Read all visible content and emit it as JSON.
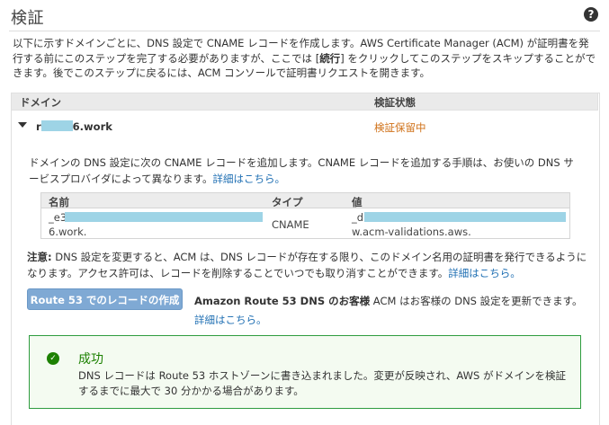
{
  "page": {
    "title": "検証",
    "intro_parts": [
      "以下に示すドメインごとに、DNS 設定で CNAME レコードを作成します。AWS Certificate Manager (ACM) が証明書を発行する前にこのステップを完了する必要がありますが、ここでは [",
      "続行",
      "] をクリックしてこのステップをスキップすることができます。後でこのステップに戻るには、ACM コンソールで証明書リクエストを開きます。"
    ]
  },
  "table": {
    "col_domain": "ドメイン",
    "col_status": "検証状態",
    "row": {
      "domain_prefix": "r",
      "domain_suffix": "6.work",
      "status": "検証保留中"
    }
  },
  "dns_note": {
    "text": "ドメインの DNS 設定に次の CNAME レコードを追加します。CNAME レコードを追加する手順は、お使いの DNS サービスプロバイダによって異なります。",
    "link": "詳細はこちら。"
  },
  "record": {
    "h_name": "名前",
    "h_type": "タイプ",
    "h_value": "値",
    "name_line1": "_e3",
    "name_line2": "6.work.",
    "type": "CNAME",
    "value_line1": "_d",
    "value_line2": "w.acm-validations.aws."
  },
  "note": {
    "label": "注意:",
    "text": " DNS 設定を変更すると、ACM は、DNS レコードが存在する限り、このドメイン名用の証明書を発行できるようになります。アクセス許可は、レコードを削除することでいつでも取り消すことができます。",
    "link": "詳細はこちら。"
  },
  "route53": {
    "button": "Route 53 でのレコードの作成",
    "bold": "Amazon Route 53 DNS のお客様",
    "text": " ACM はお客様の DNS 設定を更新できます。",
    "link": "詳細はこちら。"
  },
  "success": {
    "title": "成功",
    "text": "DNS レコードは Route 53 ホストゾーンに書き込まれました。変更が反映され、AWS がドメインを検証するまでに最大で 30 分かかる場合があります。"
  },
  "colors": {
    "link": "#1f6fb3",
    "pending": "#d0721a",
    "success": "#1d8102",
    "button": "#7fa9d4",
    "redaction": "#9ed4e6"
  },
  "icons": [
    "help-icon",
    "caret-down-icon",
    "check-circle-icon"
  ]
}
